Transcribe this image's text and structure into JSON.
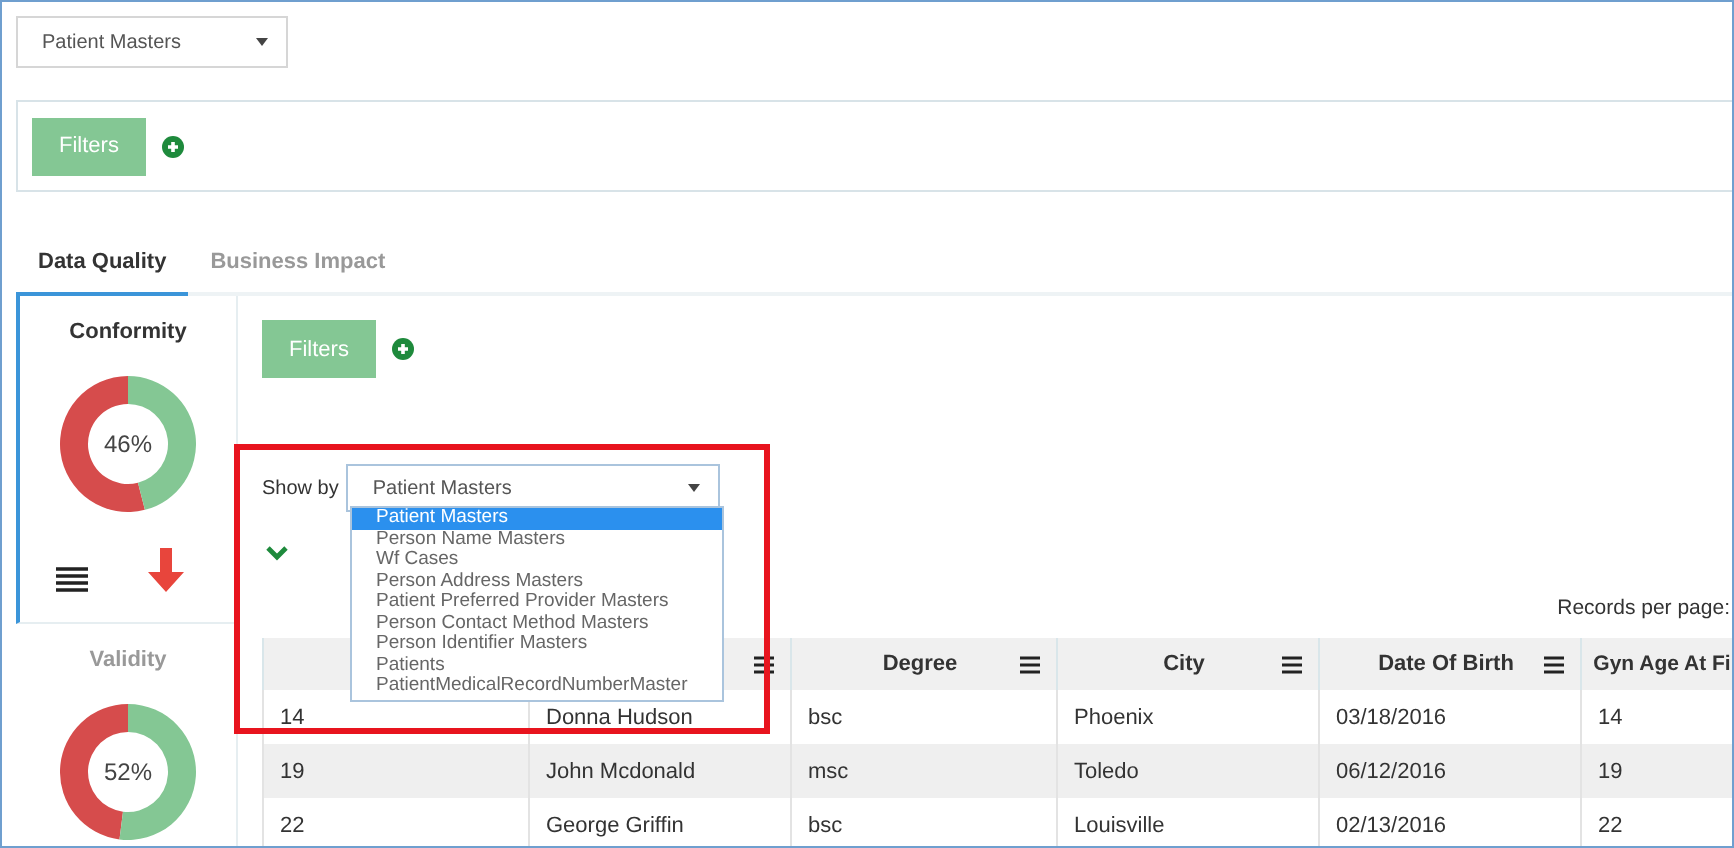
{
  "top_select": {
    "value": "Patient Masters"
  },
  "filters_bar": {
    "button": "Filters"
  },
  "tabs": [
    {
      "label": "Data Quality",
      "selected": true
    },
    {
      "label": "Business Impact",
      "selected": false
    }
  ],
  "metrics": [
    {
      "title": "Conformity",
      "selected": true,
      "level": 0.46,
      "reading": "46%"
    },
    {
      "title": "Validity",
      "selected": false,
      "level": 0.52,
      "reading": "52%"
    }
  ],
  "content": {
    "filters_button": "Filters",
    "show_by_label": "Show by",
    "show_by_value": "Patient Masters",
    "show_by_options": [
      {
        "label": "Patient Masters",
        "selected": true
      },
      {
        "label": "Person Name Masters",
        "selected": false
      },
      {
        "label": "Wf Cases",
        "selected": false
      },
      {
        "label": "Person Address Masters",
        "selected": false
      },
      {
        "label": "Patient Preferred Provider Masters",
        "selected": false
      },
      {
        "label": "Person Contact Method Masters",
        "selected": false
      },
      {
        "label": "Person Identifier Masters",
        "selected": false
      },
      {
        "label": "Patients",
        "selected": false
      },
      {
        "label": "PatientMedicalRecordNumberMaster",
        "selected": false
      }
    ],
    "records_per_page": "Records per page:"
  },
  "table": {
    "columns": [
      {},
      {
        "menu": true
      },
      {
        "label": "Degree",
        "menu": true
      },
      {
        "label": "City",
        "menu": true
      },
      {
        "label": "Date Of Birth",
        "menu": true
      },
      {
        "label": "Gyn Age At Fi"
      }
    ],
    "rows": [
      [
        "14",
        "Donna Hudson",
        "bsc",
        "Phoenix",
        "03/18/2016",
        "14"
      ],
      [
        "19",
        "John Mcdonald",
        "msc",
        "Toledo",
        "06/12/2016",
        "19"
      ],
      [
        "22",
        "George Griffin",
        "bsc",
        "Louisville",
        "02/13/2016",
        "22"
      ]
    ]
  }
}
